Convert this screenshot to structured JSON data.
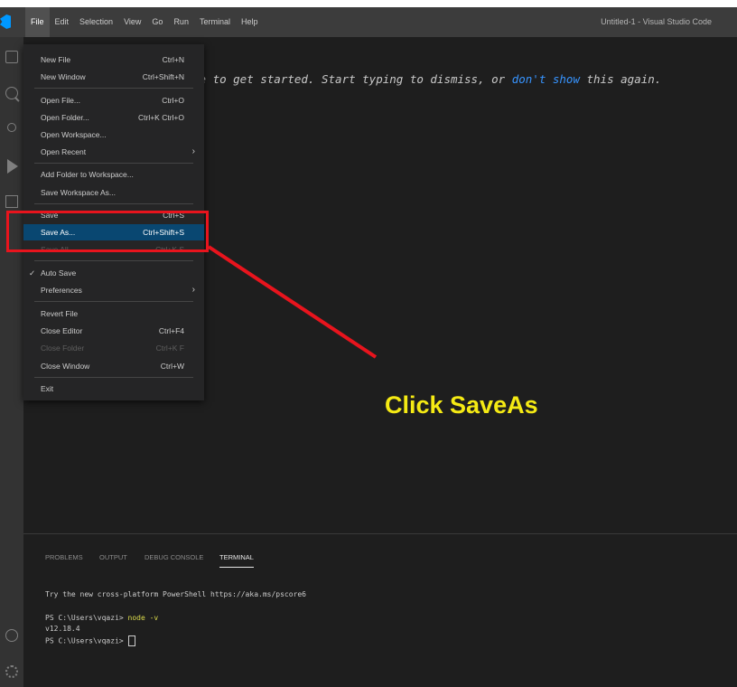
{
  "titlebar": {
    "menu": [
      "File",
      "Edit",
      "Selection",
      "View",
      "Go",
      "Run",
      "Terminal",
      "Help"
    ],
    "window_title": "Untitled-1 - Visual Studio Code"
  },
  "activity_bar": {
    "icons": [
      "files-icon",
      "search-icon",
      "source-control-icon",
      "run-debug-icon",
      "extensions-icon",
      "account-icon",
      "manage-gear-icon"
    ]
  },
  "editor": {
    "hint_prefix": "ge to get started. Start typing to dismiss, or ",
    "hint_link": "don't show",
    "hint_suffix": " this again."
  },
  "file_menu": {
    "new_file": {
      "label": "New File",
      "shortcut": "Ctrl+N"
    },
    "new_window": {
      "label": "New Window",
      "shortcut": "Ctrl+Shift+N"
    },
    "open_file": {
      "label": "Open File...",
      "shortcut": "Ctrl+O"
    },
    "open_folder": {
      "label": "Open Folder...",
      "shortcut": "Ctrl+K Ctrl+O"
    },
    "open_workspace": {
      "label": "Open Workspace..."
    },
    "open_recent": {
      "label": "Open Recent"
    },
    "add_folder": {
      "label": "Add Folder to Workspace..."
    },
    "save_workspace_as": {
      "label": "Save Workspace As..."
    },
    "save": {
      "label": "Save",
      "shortcut": "Ctrl+S"
    },
    "save_as": {
      "label": "Save As...",
      "shortcut": "Ctrl+Shift+S"
    },
    "save_all": {
      "label": "Save All",
      "shortcut": "Ctrl+K S"
    },
    "auto_save": {
      "label": "Auto Save",
      "check": "✓"
    },
    "preferences": {
      "label": "Preferences"
    },
    "revert_file": {
      "label": "Revert File"
    },
    "close_editor": {
      "label": "Close Editor",
      "shortcut": "Ctrl+F4"
    },
    "close_folder": {
      "label": "Close Folder",
      "shortcut": "Ctrl+K F"
    },
    "close_window": {
      "label": "Close Window",
      "shortcut": "Ctrl+W"
    },
    "exit": {
      "label": "Exit"
    }
  },
  "annotation": {
    "text": "Click SaveAs",
    "color": "#e8141d",
    "text_color": "#f5ea14"
  },
  "panel": {
    "tabs": [
      "PROBLEMS",
      "OUTPUT",
      "DEBUG CONSOLE",
      "TERMINAL"
    ],
    "active_tab": "TERMINAL",
    "terminal": {
      "line1": "Try the new cross-platform PowerShell https://aka.ms/pscore6",
      "prompt1": "PS C:\\Users\\vqazi> ",
      "command1": "node -v",
      "output1": "v12.18.4",
      "prompt2": "PS C:\\Users\\vqazi> "
    }
  }
}
